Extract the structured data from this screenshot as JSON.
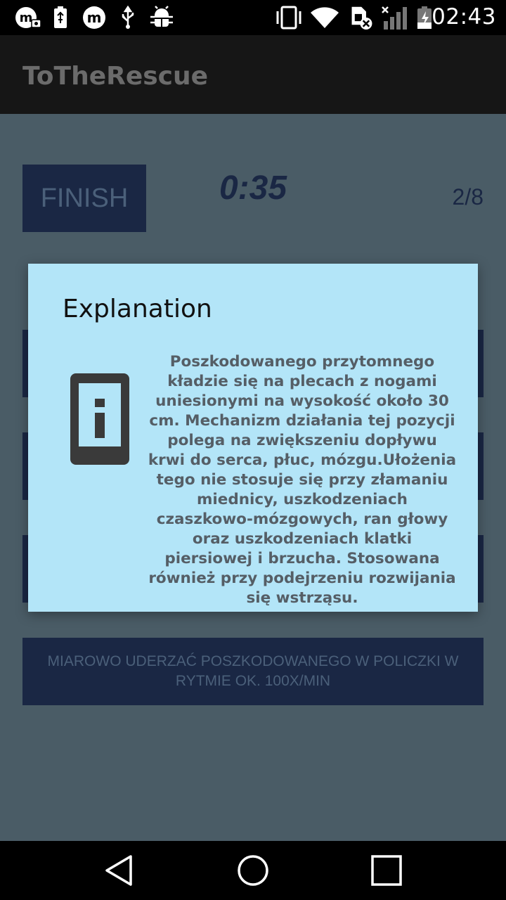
{
  "status_bar": {
    "time": "02:43",
    "left_icons": [
      "m-camera-notification-icon",
      "usb-battery-icon",
      "m-notification-icon",
      "usb-icon",
      "android-debug-icon"
    ],
    "right_icons": [
      "vibrate-icon",
      "wifi-icon",
      "sim-error-icon",
      "signal-icon",
      "battery-charging-icon"
    ]
  },
  "app_bar": {
    "title": "ToTheRescue"
  },
  "quiz": {
    "finish_label": "FINISH",
    "timer": "0:35",
    "progress": "2/8",
    "answers": [
      "",
      "",
      "",
      "MIAROWO UDERZAĆ POSZKODOWANEGO W POLICZKI W RYTMIE OK. 100X/MIN"
    ]
  },
  "dialog": {
    "title": "Explanation",
    "icon": "info-icon",
    "body": "Poszkodowanego przytomnego kładzie się na plecach z nogami uniesionymi na wysokość około 30 cm. Mechanizm działania tej pozycji polega na zwiększeniu dopływu krwi do serca, płuc, mózgu.Ułożenia tego nie stosuje się przy złamaniu miednicy, uszkodzeniach czaszkowo-mózgowych, ran głowy oraz uszkodzeniach klatki piersiowej i brzucha. Stosowana również przy podejrzeniu rozwijania się wstrząsu."
  },
  "nav_bar": {
    "buttons": [
      "back-icon",
      "home-icon",
      "recents-icon"
    ]
  },
  "colors": {
    "dialog_bg": "#b3e5f8",
    "button_bg": "#1a2744",
    "content_bg": "#4a5c66"
  }
}
